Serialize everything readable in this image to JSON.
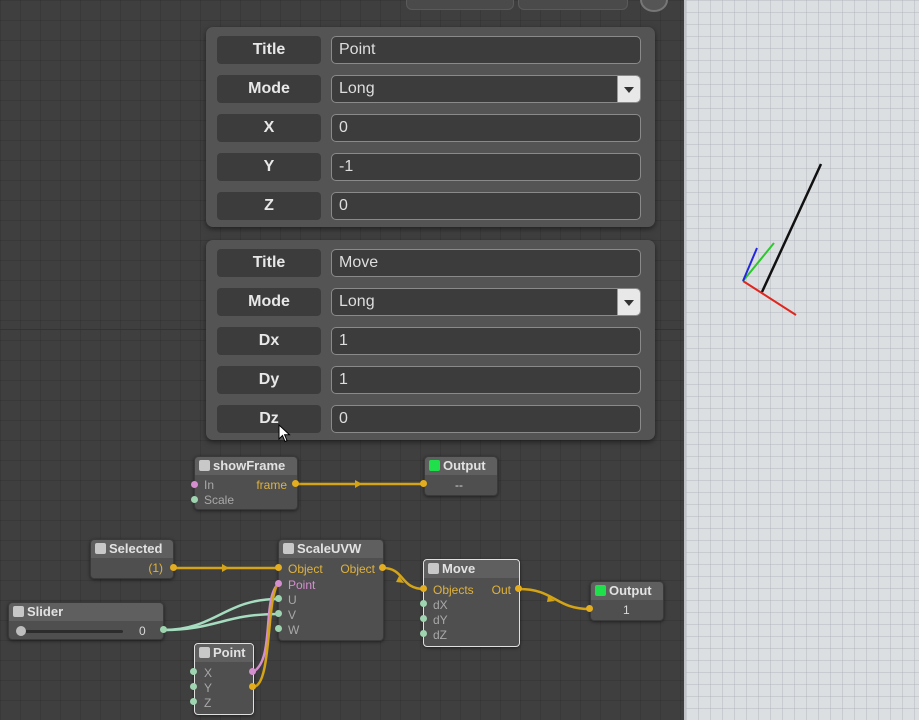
{
  "panel_point": {
    "rows": [
      {
        "label": "Title",
        "value": "Point",
        "type": "text"
      },
      {
        "label": "Mode",
        "value": "Long",
        "type": "select"
      },
      {
        "label": "X",
        "value": "0",
        "type": "text"
      },
      {
        "label": "Y",
        "value": "-1",
        "type": "text"
      },
      {
        "label": "Z",
        "value": "0",
        "type": "text"
      }
    ]
  },
  "panel_move": {
    "rows": [
      {
        "label": "Title",
        "value": "Move",
        "type": "text"
      },
      {
        "label": "Mode",
        "value": "Long",
        "type": "select"
      },
      {
        "label": "Dx",
        "value": "1",
        "type": "text"
      },
      {
        "label": "Dy",
        "value": "1",
        "type": "text"
      },
      {
        "label": "Dz",
        "value": "0",
        "type": "text"
      }
    ]
  },
  "nodes": {
    "showframe": {
      "title": "showFrame",
      "in1": "In",
      "in2": "Scale",
      "out": "frame"
    },
    "output1": {
      "title": "Output",
      "value": "--"
    },
    "selected": {
      "title": "Selected",
      "value": "(1)"
    },
    "scaleuvw": {
      "title": "ScaleUVW",
      "in1": "Object",
      "in2": "Point",
      "in3": "U",
      "in4": "V",
      "in5": "W",
      "out": "Object"
    },
    "move": {
      "title": "Move",
      "in1": "Objects",
      "in2": "dX",
      "in3": "dY",
      "in4": "dZ",
      "out": "Out"
    },
    "output2": {
      "title": "Output",
      "value": "1"
    },
    "slider": {
      "title": "Slider",
      "value": "0"
    },
    "point": {
      "title": "Point",
      "in1": "X",
      "in2": "Y",
      "in3": "Z"
    }
  },
  "colors": {
    "checkbox_on": "#1fe04a",
    "wire_yellow": "#d4a416",
    "wire_green": "#a6dcc0",
    "wire_pink": "#d58fcf"
  }
}
